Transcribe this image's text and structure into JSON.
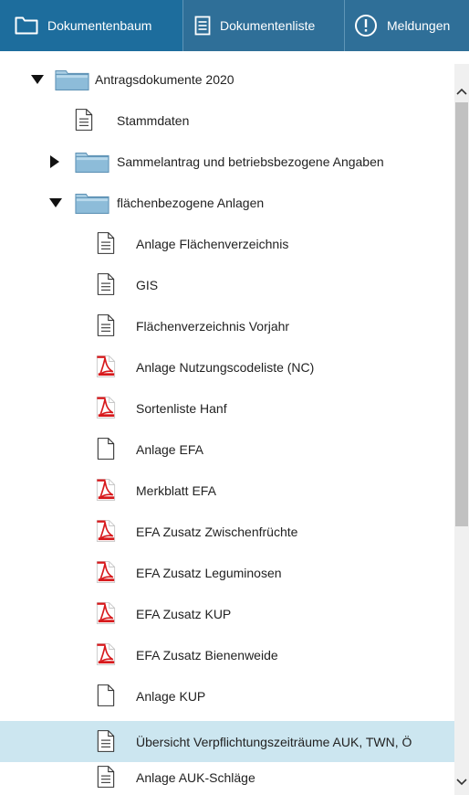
{
  "tabs": {
    "tree": {
      "label": "Dokumentenbaum",
      "icon": "folder-icon",
      "active": true
    },
    "list": {
      "label": "Dokumentenliste",
      "icon": "document-list-icon"
    },
    "messages": {
      "label": "Meldungen",
      "icon": "exclamation-circle-icon"
    }
  },
  "colors": {
    "tabbar": "#2f6f98",
    "tab_active": "#1d6d9d",
    "selected_row": "#cce6f0",
    "pdf_red": "#d7191c",
    "folder_blue": "#7fb2d3"
  },
  "tree": {
    "root": {
      "label": "Antragsdokumente 2020",
      "expanded": true,
      "children": [
        {
          "label": "Stammdaten",
          "type": "doc"
        },
        {
          "label": "Sammelantrag und betriebsbezogene Angaben",
          "type": "folder",
          "expanded": false
        },
        {
          "label": "flächenbezogene Anlagen",
          "type": "folder",
          "expanded": true,
          "children": [
            {
              "label": "Anlage Flächenverzeichnis",
              "type": "doc"
            },
            {
              "label": "GIS",
              "type": "doc"
            },
            {
              "label": "Flächenverzeichnis Vorjahr",
              "type": "doc"
            },
            {
              "label": "Anlage Nutzungscodeliste (NC)",
              "type": "pdf"
            },
            {
              "label": "Sortenliste Hanf",
              "type": "pdf"
            },
            {
              "label": "Anlage EFA",
              "type": "blank"
            },
            {
              "label": "Merkblatt EFA",
              "type": "pdf"
            },
            {
              "label": "EFA Zusatz Zwischenfrüchte",
              "type": "pdf"
            },
            {
              "label": "EFA Zusatz Leguminosen",
              "type": "pdf"
            },
            {
              "label": "EFA Zusatz KUP",
              "type": "pdf"
            },
            {
              "label": "EFA Zusatz Bienenweide",
              "type": "pdf"
            },
            {
              "label": "Anlage KUP",
              "type": "blank"
            },
            {
              "label": "Übersicht Verpflichtungszeiträume AUK, TWN, Ö",
              "type": "doc",
              "selected": true
            },
            {
              "label": "Anlage AUK-Schläge",
              "type": "doc"
            }
          ]
        }
      ]
    }
  }
}
